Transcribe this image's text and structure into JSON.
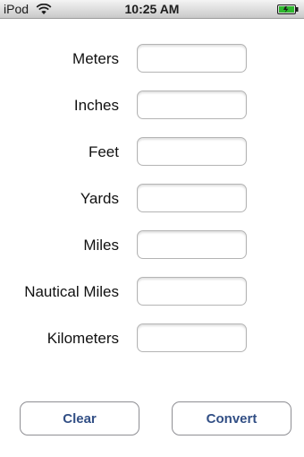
{
  "status_bar": {
    "carrier": "iPod",
    "time": "10:25 AM",
    "wifi_icon": "wifi-icon",
    "battery_icon": "battery-charging-icon",
    "battery_color": "#2fb82f"
  },
  "form": {
    "fields": [
      {
        "label": "Meters",
        "value": ""
      },
      {
        "label": "Inches",
        "value": ""
      },
      {
        "label": "Feet",
        "value": ""
      },
      {
        "label": "Yards",
        "value": ""
      },
      {
        "label": "Miles",
        "value": ""
      },
      {
        "label": "Nautical Miles",
        "value": ""
      },
      {
        "label": "Kilometers",
        "value": ""
      }
    ]
  },
  "buttons": {
    "clear_label": "Clear",
    "convert_label": "Convert",
    "text_color": "#324f85"
  }
}
